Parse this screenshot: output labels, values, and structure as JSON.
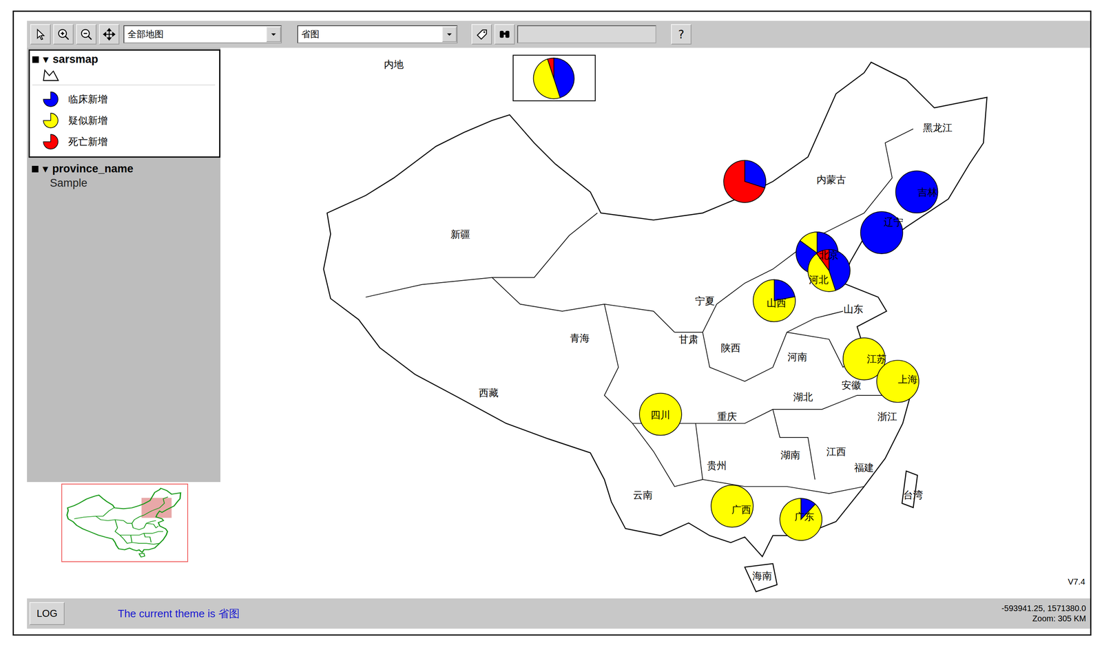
{
  "toolbar": {
    "map_select": "全部地图",
    "theme_select": "省图",
    "search_value": "",
    "help": "?"
  },
  "legend": {
    "layer": "sarsmap",
    "expanded": true,
    "visible": true,
    "toggle": "▼",
    "items": [
      {
        "label": "临床新增",
        "color": "#0000ff"
      },
      {
        "label": "疑似新增",
        "color": "#ffff00"
      },
      {
        "label": "死亡新增",
        "color": "#ff0000"
      }
    ]
  },
  "labels_layer": {
    "name": "province_name",
    "expanded": true,
    "visible": true,
    "toggle": "▼",
    "sample": "Sample"
  },
  "map": {
    "total": {
      "label": "内地",
      "values": [
        0.45,
        0.5,
        0.05
      ]
    },
    "provinces": [
      {
        "name": "黑龙江",
        "values": null
      },
      {
        "name": "吉林",
        "values": [
          1,
          0,
          0
        ]
      },
      {
        "name": "辽宁",
        "values": [
          1,
          0,
          0
        ]
      },
      {
        "name": "内蒙古",
        "values": [
          0.3,
          0,
          0.7
        ]
      },
      {
        "name": "北京",
        "values": [
          0.85,
          0.15,
          0
        ]
      },
      {
        "name": "河北",
        "values": [
          0.45,
          0.45,
          0.1
        ]
      },
      {
        "name": "山西",
        "values": [
          0.22,
          0.78,
          0
        ]
      },
      {
        "name": "山东",
        "values": null
      },
      {
        "name": "宁夏",
        "values": null
      },
      {
        "name": "新疆",
        "values": null
      },
      {
        "name": "青海",
        "values": null
      },
      {
        "name": "甘肃",
        "values": null
      },
      {
        "name": "陕西",
        "values": null
      },
      {
        "name": "河南",
        "values": null
      },
      {
        "name": "江苏",
        "values": [
          0,
          1,
          0
        ]
      },
      {
        "name": "安徽",
        "values": null
      },
      {
        "name": "上海",
        "values": [
          0,
          1,
          0
        ]
      },
      {
        "name": "湖北",
        "values": null
      },
      {
        "name": "西藏",
        "values": null
      },
      {
        "name": "四川",
        "values": [
          0,
          1,
          0
        ]
      },
      {
        "name": "重庆",
        "values": null
      },
      {
        "name": "浙江",
        "values": null
      },
      {
        "name": "湖南",
        "values": null
      },
      {
        "name": "江西",
        "values": null
      },
      {
        "name": "福建",
        "values": null
      },
      {
        "name": "贵州",
        "values": null
      },
      {
        "name": "云南",
        "values": null
      },
      {
        "name": "台湾",
        "values": null
      },
      {
        "name": "广西",
        "values": [
          0,
          1,
          0
        ]
      },
      {
        "name": "广东",
        "values": [
          0.12,
          0.88,
          0
        ]
      },
      {
        "name": "海南",
        "values": null
      }
    ],
    "version": "V7.4"
  },
  "status_bar": {
    "log": "LOG",
    "theme_text": "The current theme is 省图",
    "coords": "-593941.25, 1571380.0",
    "zoom": "Zoom: 305 KM"
  }
}
